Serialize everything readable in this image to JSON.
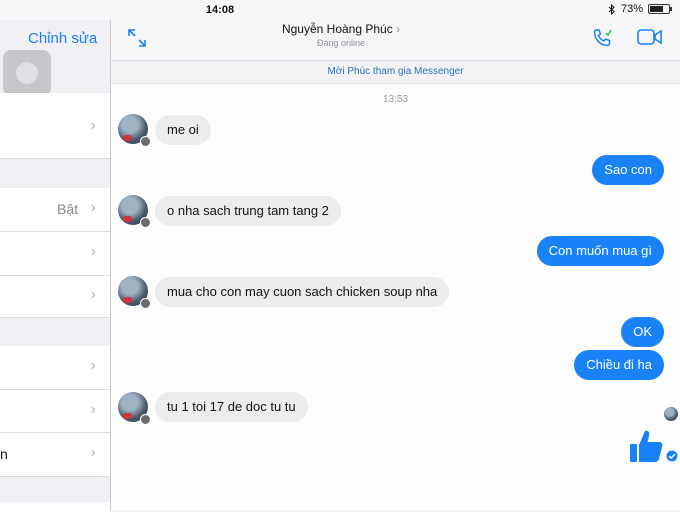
{
  "status_bar": {
    "time": "14:08",
    "battery": "73%",
    "battery_level": 0.73
  },
  "settings_pane": {
    "edit_label": "Chỉnh sửa",
    "rows": [
      {
        "value": "",
        "label": ""
      },
      {
        "value": "Bật",
        "label": ""
      },
      {
        "value": "",
        "label": ""
      },
      {
        "value": "",
        "label": ""
      },
      {
        "value": "",
        "label": ""
      },
      {
        "value": "",
        "label": ""
      },
      {
        "value": "",
        "label": "n"
      }
    ]
  },
  "chat": {
    "contact_name": "Nguyễn Hoàng Phúc",
    "contact_status": "Đang online",
    "invite_banner": "Mời Phúc tham gia Messenger",
    "timestamp": "13:53",
    "messages": [
      {
        "direction": "incoming",
        "text": "me oi"
      },
      {
        "direction": "outgoing",
        "text": "Sao con"
      },
      {
        "direction": "incoming",
        "text": "o nha sach trung tam tang 2"
      },
      {
        "direction": "outgoing",
        "text": "Con muốn mua gì"
      },
      {
        "direction": "incoming",
        "text": "mua cho con may cuon sach chicken soup nha"
      },
      {
        "direction": "outgoing",
        "text": "OK"
      },
      {
        "direction": "outgoing",
        "text": "Chiều đi ha"
      },
      {
        "direction": "incoming",
        "text": "tu 1 toi 17 de doc tu tu"
      }
    ],
    "colors": {
      "accent": "#1a82f7",
      "incoming_bubble": "#ececef"
    }
  }
}
